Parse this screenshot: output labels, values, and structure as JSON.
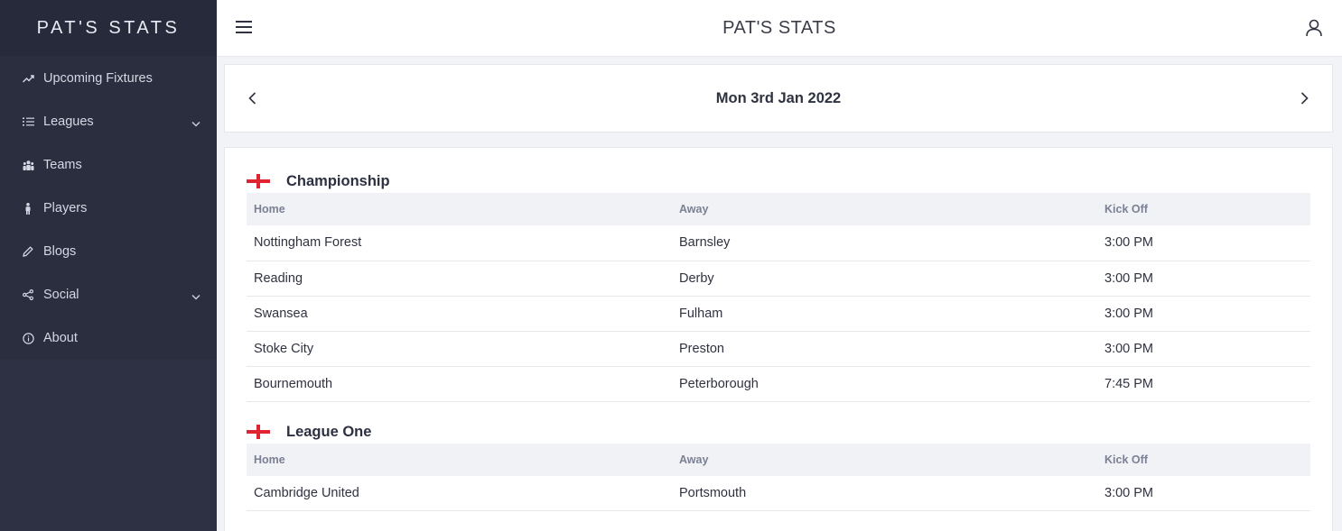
{
  "app": {
    "brand": "PAT'S STATS",
    "header_title": "PAT'S STATS"
  },
  "sidebar": {
    "items": [
      {
        "label": "Upcoming Fixtures",
        "icon": "trend-icon",
        "expandable": false
      },
      {
        "label": "Leagues",
        "icon": "list-icon",
        "expandable": true
      },
      {
        "label": "Teams",
        "icon": "team-icon",
        "expandable": false
      },
      {
        "label": "Players",
        "icon": "person-icon",
        "expandable": false
      },
      {
        "label": "Blogs",
        "icon": "pencil-icon",
        "expandable": false
      },
      {
        "label": "Social",
        "icon": "share-icon",
        "expandable": true
      },
      {
        "label": "About",
        "icon": "info-icon",
        "expandable": false
      }
    ]
  },
  "date": {
    "label": "Mon 3rd Jan 2022"
  },
  "leagues": [
    {
      "name": "Championship",
      "columns": [
        "Home",
        "Away",
        "Kick Off"
      ],
      "fixtures": [
        {
          "home": "Nottingham Forest",
          "away": "Barnsley",
          "kickoff": "3:00 PM"
        },
        {
          "home": "Reading",
          "away": "Derby",
          "kickoff": "3:00 PM"
        },
        {
          "home": "Swansea",
          "away": "Fulham",
          "kickoff": "3:00 PM"
        },
        {
          "home": "Stoke City",
          "away": "Preston",
          "kickoff": "3:00 PM"
        },
        {
          "home": "Bournemouth",
          "away": "Peterborough",
          "kickoff": "7:45 PM"
        }
      ]
    },
    {
      "name": "League One",
      "columns": [
        "Home",
        "Away",
        "Kick Off"
      ],
      "fixtures": [
        {
          "home": "Cambridge United",
          "away": "Portsmouth",
          "kickoff": "3:00 PM"
        }
      ]
    }
  ],
  "colors": {
    "sidebar": "#2d3143",
    "brand_bar": "#262a3a",
    "flag_red": "#e0242f"
  }
}
